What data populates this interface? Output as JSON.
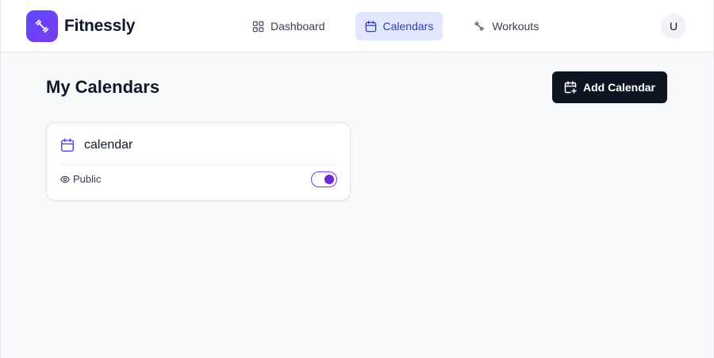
{
  "app": {
    "name": "Fitnessly",
    "logo_icon": "dumbbell-icon",
    "brand_color": "#6243f5"
  },
  "nav": {
    "items": [
      {
        "label": "Dashboard",
        "icon": "dashboard-grid-icon",
        "active": false
      },
      {
        "label": "Calendars",
        "icon": "calendar-icon",
        "active": true
      },
      {
        "label": "Workouts",
        "icon": "dumbbell-icon",
        "active": false
      }
    ],
    "active_color": "#2f3fb8"
  },
  "user": {
    "avatar_initial": "U"
  },
  "main": {
    "title": "My Calendars",
    "add_button": {
      "label": "Add Calendar",
      "icon": "calendar-plus-icon"
    }
  },
  "calendars": [
    {
      "name": "calendar",
      "icon": "calendar-icon",
      "visibility_label": "Public",
      "visibility_icon": "eye-icon",
      "public": true
    }
  ],
  "colors": {
    "toggle_on": "#6d28d9",
    "button_dark": "#0f1423"
  }
}
